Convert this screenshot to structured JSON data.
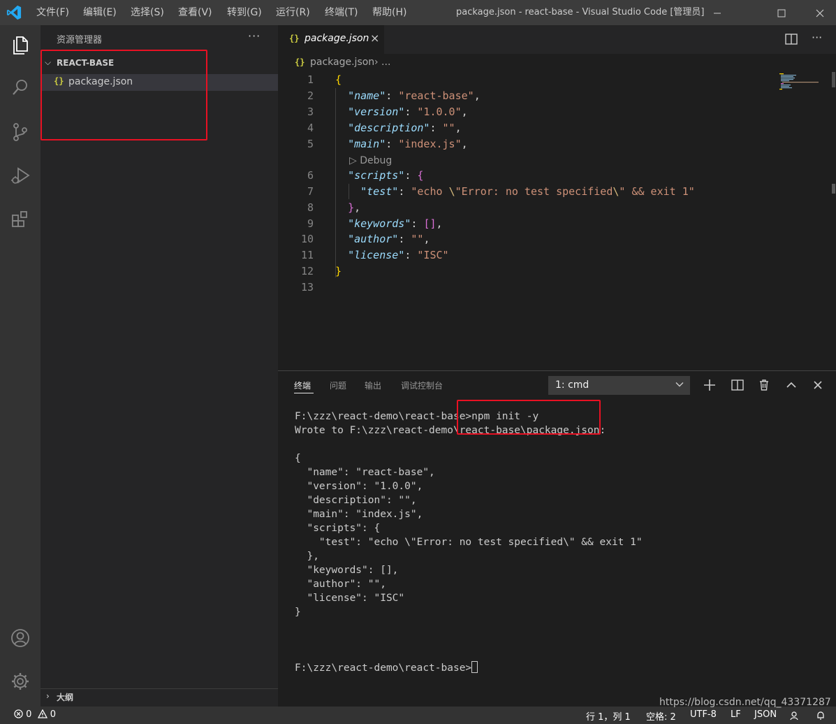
{
  "window": {
    "title": "package.json - react-base - Visual Studio Code [管理员]",
    "menu": [
      "文件(F)",
      "编辑(E)",
      "选择(S)",
      "查看(V)",
      "转到(G)",
      "运行(R)",
      "终端(T)",
      "帮助(H)"
    ]
  },
  "sidebar": {
    "title": "资源管理器",
    "more": "···",
    "folder": "REACT-BASE",
    "file_icon": "{}",
    "file": "package.json",
    "outline": "大纲"
  },
  "editor": {
    "tab_label": "package.json",
    "tab_icon": "{}",
    "tab_close": "×",
    "more": "···",
    "breadcrumb": {
      "icon": "{}",
      "file": "package.json",
      "rest": "› ..."
    },
    "codelens": "▷ Debug",
    "line_numbers": [
      "1",
      "2",
      "3",
      "4",
      "5",
      "6",
      "7",
      "8",
      "9",
      "10",
      "11",
      "12",
      "13"
    ],
    "lines": [
      "{",
      "  \"name\": \"react-base\",",
      "  \"version\": \"1.0.0\",",
      "  \"description\": \"\",",
      "  \"main\": \"index.js\",",
      "  \"scripts\": {",
      "    \"test\": \"echo \\\"Error: no test specified\\\" && exit 1\"",
      "  },",
      "  \"keywords\": [],",
      "  \"author\": \"\",",
      "  \"license\": \"ISC\"",
      "}",
      ""
    ]
  },
  "panel": {
    "tabs": [
      "终端",
      "问题",
      "输出",
      "调试控制台"
    ],
    "terminal_select": "1: cmd",
    "terminal_lines": [
      "F:\\zzz\\react-demo\\react-base>npm init -y",
      "Wrote to F:\\zzz\\react-demo\\react-base\\package.json:",
      "",
      "{",
      "  \"name\": \"react-base\",",
      "  \"version\": \"1.0.0\",",
      "  \"description\": \"\",",
      "  \"main\": \"index.js\",",
      "  \"scripts\": {",
      "    \"test\": \"echo \\\"Error: no test specified\\\" && exit 1\"",
      "  },",
      "  \"keywords\": [],",
      "  \"author\": \"\",",
      "  \"license\": \"ISC\"",
      "}",
      "",
      "",
      ""
    ],
    "prompt": "F:\\zzz\\react-demo\\react-base>"
  },
  "statusbar": {
    "errors": "0",
    "warnings": "0",
    "position": "行 1，列 1",
    "indent": "空格: 2",
    "encoding": "UTF-8",
    "eol": "LF",
    "language": "JSON"
  },
  "watermark": "https://blog.csdn.net/qq_43371287",
  "colors": {
    "highlight_box": "#e81123",
    "accent": "#007acc"
  }
}
